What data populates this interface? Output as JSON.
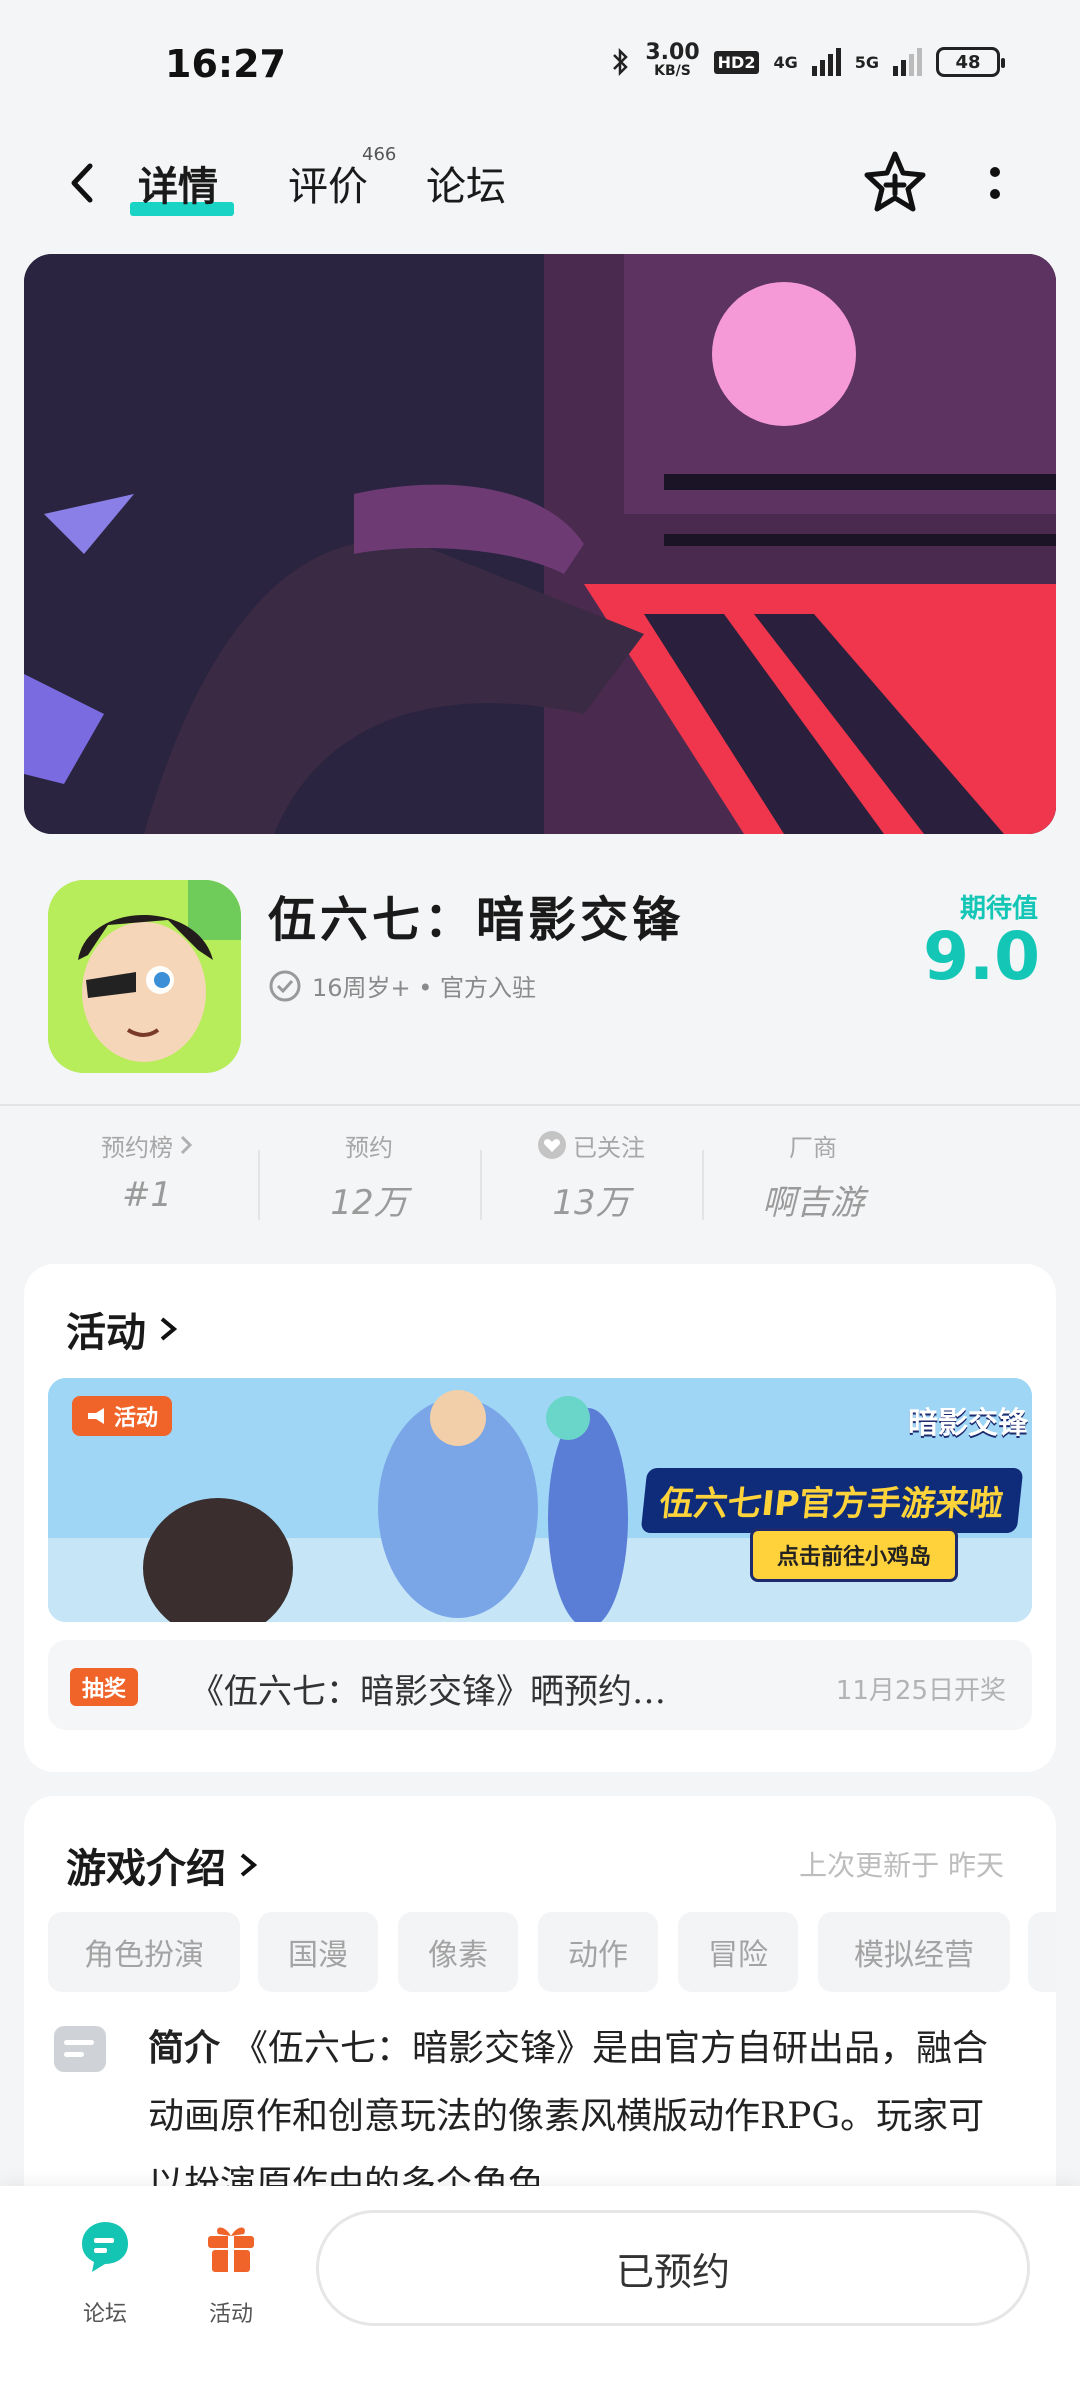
{
  "status_bar": {
    "time": "16:27",
    "speed_value": "3.00",
    "speed_unit": "KB/S",
    "hd_badge": "HD2",
    "net1": "4G",
    "net2": "5G",
    "battery": "48"
  },
  "nav": {
    "tabs": [
      {
        "label": "详情",
        "active": true
      },
      {
        "label": "评价",
        "badge": "466"
      },
      {
        "label": "论坛"
      }
    ]
  },
  "app": {
    "name": "伍六七：暗影交锋",
    "subtitle": "16周岁+ • 官方入驻",
    "expect_label": "期待值",
    "expect_value": "9.0"
  },
  "stats": [
    {
      "label": "预约榜",
      "value": "#1"
    },
    {
      "label": "预约",
      "value": "12万"
    },
    {
      "label": "已关注",
      "value": "13万"
    },
    {
      "label": "厂商",
      "value": "啊吉游"
    }
  ],
  "events": {
    "title": "活动",
    "banner": {
      "tag": "活动",
      "logo_text": "暗影交锋",
      "headline": "伍六七IP官方手游来啦",
      "cta": "点击前往小鸡岛"
    },
    "lottery": {
      "tag": "抽奖",
      "text": "《伍六七：暗影交锋》晒预约…",
      "date": "11月25日开奖"
    }
  },
  "intro": {
    "title": "游戏介绍",
    "updated": "上次更新于 昨天",
    "tags": [
      "角色扮演",
      "国漫",
      "像素",
      "动作",
      "冒险",
      "模拟经营"
    ],
    "label": "简介",
    "text": "《伍六七：暗影交锋》是由官方自研出品，融合动画原作和创意玩法的像素风横版动作RPG。玩家可以扮演原作中的多个角色。…"
  },
  "bottom_bar": {
    "forum_label": "论坛",
    "activity_label": "活动",
    "reserve_label": "已预约"
  },
  "colors": {
    "accent": "#13c6b6",
    "orange": "#f0642a"
  }
}
